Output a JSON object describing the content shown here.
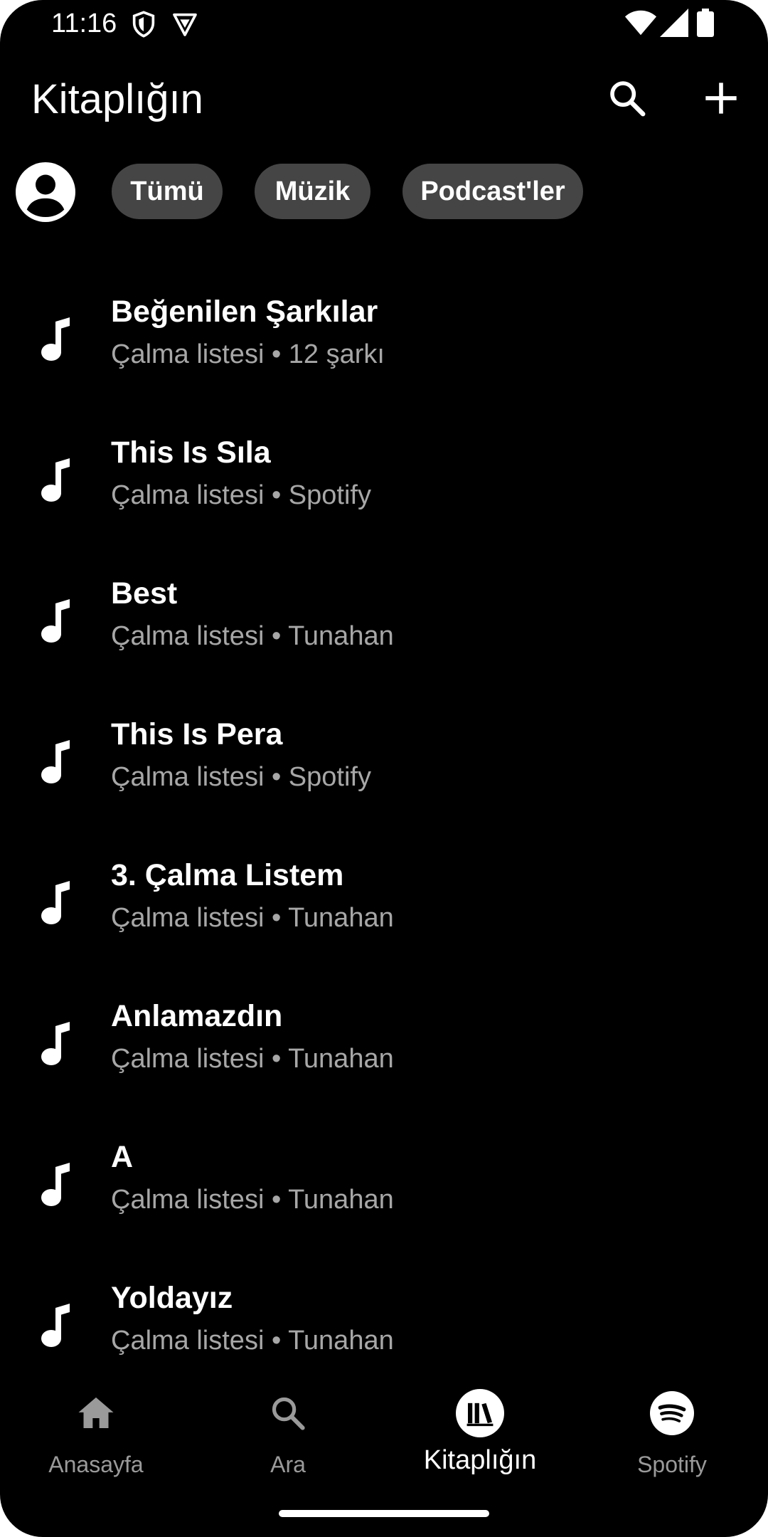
{
  "status_bar": {
    "time": "11:16",
    "left_icons": [
      "shield-icon",
      "vpn-icon"
    ],
    "right_icons": [
      "wifi-icon",
      "signal-icon",
      "battery-icon"
    ]
  },
  "header": {
    "title": "Kitaplığın",
    "actions": [
      "search-icon",
      "add-icon"
    ]
  },
  "filters": {
    "avatar_icon": "account-circle-icon",
    "chips": [
      "Tümü",
      "Müzik",
      "Podcast'ler"
    ]
  },
  "library": {
    "item_icon": "music-note-icon",
    "items": [
      {
        "title": "Beğenilen Şarkılar",
        "subtitle": "Çalma listesi • 12 şarkı"
      },
      {
        "title": "This Is Sıla",
        "subtitle": "Çalma listesi • Spotify"
      },
      {
        "title": "Best",
        "subtitle": "Çalma listesi • Tunahan"
      },
      {
        "title": "This Is Pera",
        "subtitle": "Çalma listesi • Spotify"
      },
      {
        "title": "3. Çalma Listem",
        "subtitle": "Çalma listesi • Tunahan"
      },
      {
        "title": "Anlamazdın",
        "subtitle": "Çalma listesi • Tunahan"
      },
      {
        "title": "A",
        "subtitle": "Çalma listesi • Tunahan"
      },
      {
        "title": "Yoldayız",
        "subtitle": "Çalma listesi • Tunahan"
      }
    ]
  },
  "bottom_nav": {
    "items": [
      {
        "label": "Anasayfa",
        "icon": "home-icon",
        "active": false
      },
      {
        "label": "Ara",
        "icon": "search-icon",
        "active": false
      },
      {
        "label": "Kitaplığın",
        "icon": "library-icon",
        "active": true
      },
      {
        "label": "Spotify",
        "icon": "spotify-logo-icon",
        "active": false
      }
    ]
  },
  "colors": {
    "background": "#000000",
    "chip": "#454545",
    "secondary_text": "#a7a7a7",
    "inactive_nav": "#9a9a9a"
  }
}
